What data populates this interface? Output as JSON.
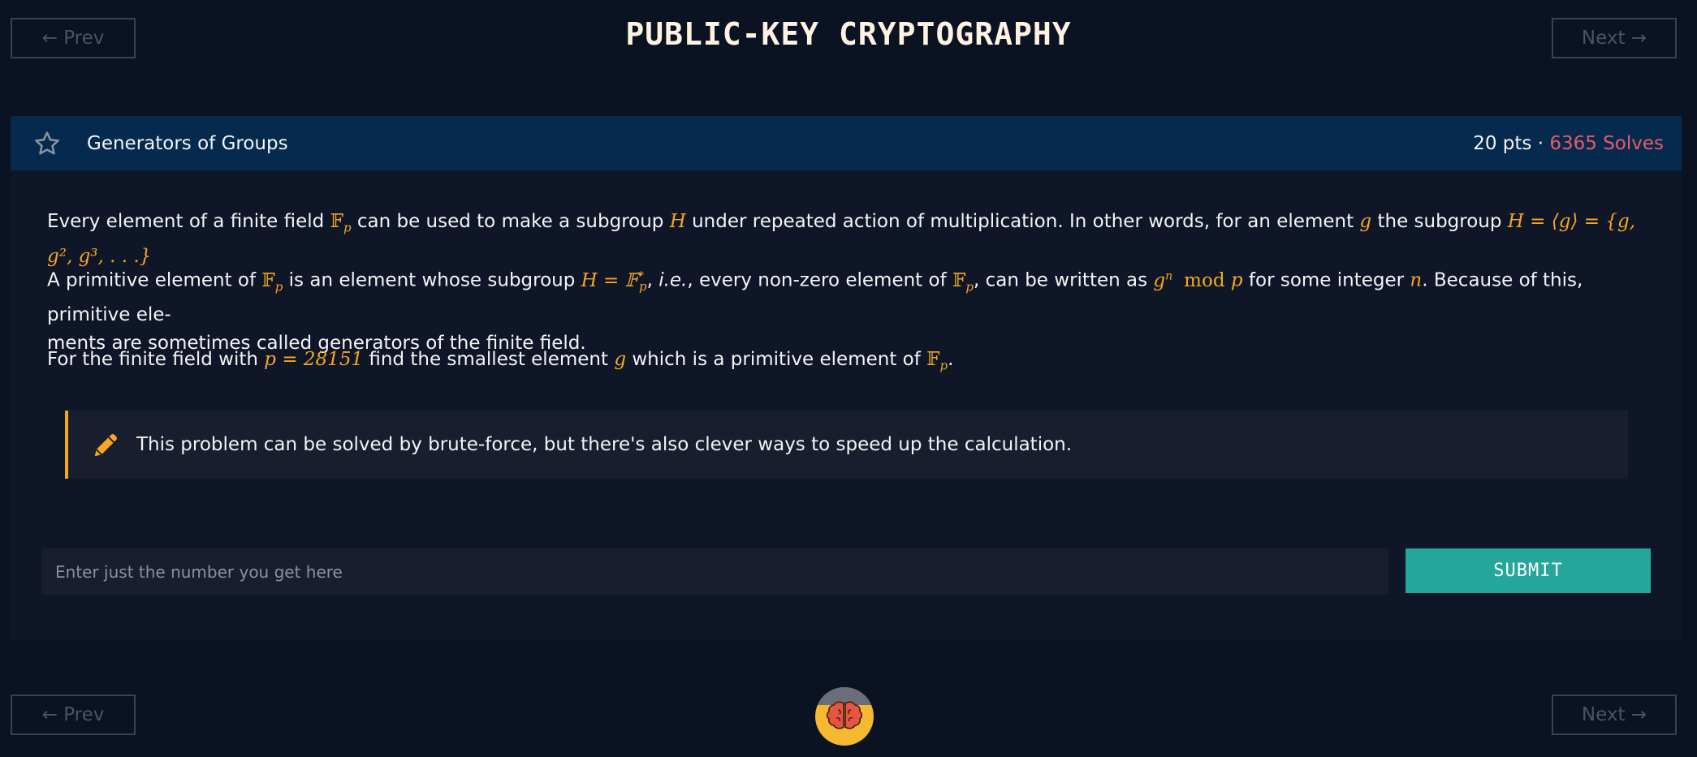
{
  "nav": {
    "prev_label": "← Prev",
    "next_label": "Next →"
  },
  "page_title": "PUBLIC-KEY CRYPTOGRAPHY",
  "challenge": {
    "title": "Generators of Groups",
    "points": "20 pts",
    "separator": " · ",
    "solves": "6365 Solves"
  },
  "paragraphs": {
    "p1": {
      "t1": "Every element of a finite field ",
      "m1": "𝔽",
      "m1sub": "p",
      "t2": " can be used to make a subgroup ",
      "m2": "H",
      "t3": " under repeated action of multiplication. In other words, for an element ",
      "m3": "g",
      "t4": " the subgroup ",
      "m4": "H = ⟨g⟩ = {g, g², g³, . . .}"
    },
    "p2": {
      "t1": "A primitive element of ",
      "m1": "𝔽",
      "m1sub": "p",
      "t2": " is an element whose subgroup ",
      "m2": "H = 𝔽",
      "m2sup": "*",
      "m2sub": "p",
      "t3": ", ",
      "ie": "i.e.",
      "t4": ", every non-zero element of ",
      "m3": "𝔽",
      "m3sub": "p",
      "t5": ", can be written as ",
      "m4": "g",
      "m4sup": "n",
      "m4b": "mod",
      "m4c": "p",
      "t6": " for some integer ",
      "m5": "n",
      "t7": ". Because of this, primitive ele-",
      "t8": "ments are sometimes called generators of the finite field."
    },
    "p3": {
      "t1": "For the finite field with ",
      "m1": "p = 28151",
      "t2": " find the smallest element ",
      "m2": "g",
      "t3": " which is a primitive element of ",
      "m3": "𝔽",
      "m3sub": "p",
      "t4": "."
    }
  },
  "hint": {
    "icon": "pencil-icon",
    "text": "This problem can be solved by brute-force, but there's also clever ways to speed up the calculation."
  },
  "answer": {
    "placeholder": "Enter just the number you get here",
    "value": "",
    "submit_label": "SUBMIT"
  },
  "colors": {
    "background": "#0b1222",
    "header": "#062a4d",
    "accent": "#f5a623",
    "solves": "#e85a6b",
    "submit": "#26a69a"
  }
}
